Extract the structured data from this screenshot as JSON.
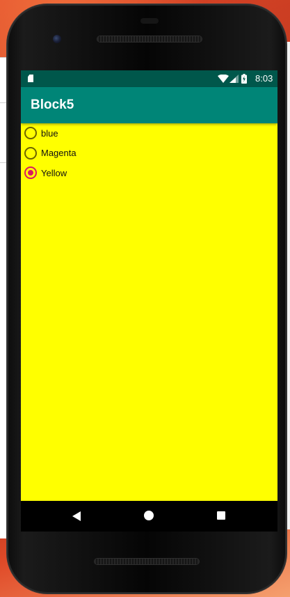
{
  "status_bar": {
    "time": "8:03",
    "icons": [
      "sd-card-icon",
      "wifi-icon",
      "signal-icon",
      "battery-charging-icon"
    ]
  },
  "app_bar": {
    "title": "Block5",
    "color": "#008577"
  },
  "content": {
    "background_color": "#ffff00",
    "radio_options": [
      {
        "label": "blue",
        "checked": false
      },
      {
        "label": "Magenta",
        "checked": false
      },
      {
        "label": "Yellow",
        "checked": true
      }
    ],
    "accent_color": "#d81b60"
  },
  "nav_bar": {
    "buttons": [
      "back-icon",
      "home-icon",
      "recents-icon"
    ]
  }
}
